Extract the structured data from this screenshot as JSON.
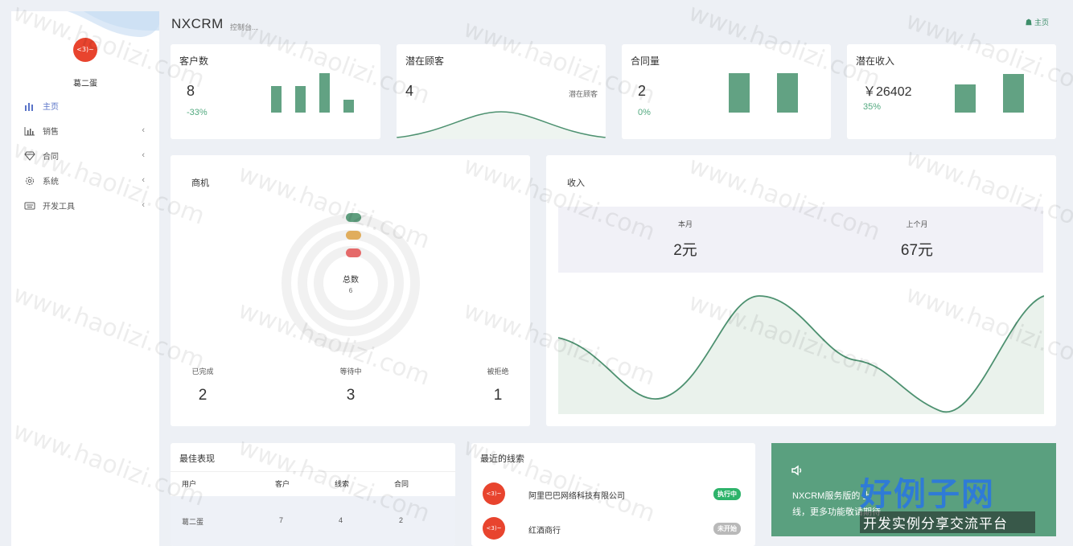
{
  "app": {
    "title": "NXCRM",
    "subtitle": "控制台...",
    "home_link": "主页"
  },
  "sidebar": {
    "avatar_text": "<3)~",
    "user_name": "葛二蛋",
    "items": [
      {
        "label": "主页",
        "icon": "bar-chart-icon",
        "active": true
      },
      {
        "label": "销售",
        "icon": "chart-icon",
        "active": false
      },
      {
        "label": "合同",
        "icon": "diamond-icon",
        "active": false
      },
      {
        "label": "系统",
        "icon": "gear-icon",
        "active": false
      },
      {
        "label": "开发工具",
        "icon": "keyboard-icon",
        "active": false
      }
    ]
  },
  "kpis": [
    {
      "title": "客户数",
      "value": "8",
      "pct": "-33%"
    },
    {
      "title": "潜在顾客",
      "value": "4",
      "note": "潜在顾客"
    },
    {
      "title": "合同量",
      "value": "2",
      "pct": "0%"
    },
    {
      "title": "潜在收入",
      "value": "￥26402",
      "pct": "35%"
    }
  ],
  "opportunities": {
    "title": "商机",
    "total_label": "总数",
    "total_value": "6",
    "stats": [
      {
        "label": "已完成",
        "value": "2",
        "color": "#5f9e7e"
      },
      {
        "label": "等待中",
        "value": "3",
        "color": "#e0ad5d"
      },
      {
        "label": "被拒绝",
        "value": "1",
        "color": "#e56a6a"
      }
    ]
  },
  "revenue": {
    "title": "收入",
    "this_month_label": "本月",
    "this_month_value": "2元",
    "last_month_label": "上个月",
    "last_month_value": "67元"
  },
  "best": {
    "title": "最佳表现",
    "headers": [
      "用户",
      "客户",
      "线索",
      "合同"
    ],
    "rows": [
      [
        "葛二蛋",
        "7",
        "4",
        "2"
      ]
    ]
  },
  "leads": {
    "title": "最近的线索",
    "items": [
      {
        "avatar": "<3)~",
        "name": "阿里巴巴网络科技有限公司",
        "status": "执行中",
        "status_color": "#2db36a"
      },
      {
        "avatar": "<3)~",
        "name": "红酒商行",
        "status": "未开始",
        "status_color": "#b9b9b9"
      }
    ]
  },
  "announcement": {
    "icon": "speaker-icon",
    "line1": "NXCRM服务版的",
    "line1_end": "上",
    "line2": "线，更多功能敬请期待"
  },
  "watermark": {
    "text": "www.haolizi.com",
    "brand_big": "好例子网",
    "brand_small": "开发实例分享交流平台"
  },
  "colors": {
    "accent": "#62a283",
    "brand_red": "#e8442e",
    "nav_active": "#5a74c8"
  }
}
